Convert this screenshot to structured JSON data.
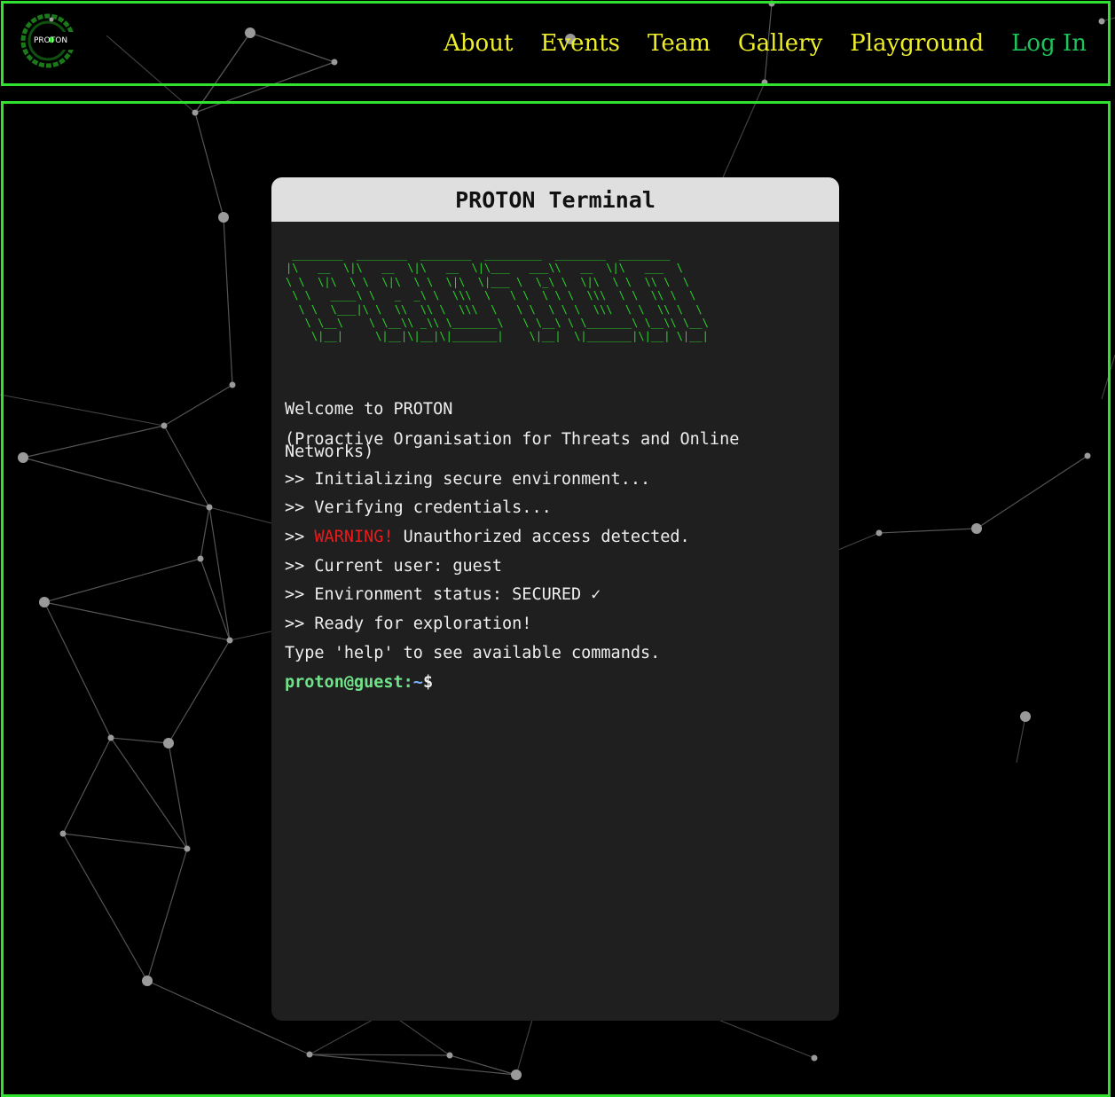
{
  "brand": {
    "logo_text": "PROTON",
    "accent": "#2fe32f"
  },
  "nav": {
    "items": [
      {
        "label": "About"
      },
      {
        "label": "Events"
      },
      {
        "label": "Team"
      },
      {
        "label": "Gallery"
      },
      {
        "label": "Playground"
      }
    ],
    "login_label": "Log In",
    "link_color": "#eded2a",
    "login_color": "#1ec45a"
  },
  "terminal": {
    "title": "PROTON Terminal",
    "ascii_art": " ________  ________  ________  _________  ________  ________      \n|\\   __  \\|\\   __  \\|\\   __  \\|\\___   ___\\\\   __  \\|\\   ___  \\    \n\\ \\  \\|\\  \\ \\  \\|\\  \\ \\  \\|\\  \\|___ \\  \\_\\ \\  \\|\\  \\ \\  \\\\ \\  \\   \n \\ \\   ____\\ \\   _  _\\ \\  \\\\\\  \\   \\ \\  \\ \\ \\  \\\\\\  \\ \\  \\\\ \\  \\  \n  \\ \\  \\___|\\ \\  \\\\  \\\\ \\  \\\\\\  \\   \\ \\  \\ \\ \\  \\\\\\  \\ \\  \\\\ \\  \\ \n   \\ \\__\\    \\ \\__\\\\ _\\\\ \\_______\\   \\ \\__\\ \\ \\_______\\ \\__\\\\ \\__\\\n    \\|__|     \\|__|\\|__|\\|_______|    \\|__|  \\|_______|\\|__| \\|__|",
    "lines": {
      "welcome": "Welcome to PROTON",
      "fullname": "(Proactive Organisation for Threats and Online Networks)",
      "init": ">> Initializing secure environment...",
      "verify": ">> Verifying credentials...",
      "warn_prefix": ">> ",
      "warn_word": "WARNING!",
      "warn_rest": " Unauthorized access detected.",
      "user": ">> Current user: guest",
      "status": ">> Environment status: SECURED ✓",
      "ready": ">> Ready for exploration!",
      "help": "Type 'help' to see available commands."
    },
    "prompt": {
      "user": "proton@guest:",
      "dir": "~",
      "symbol": "$",
      "value": ""
    },
    "colors": {
      "ascii": "#27d527",
      "warning": "#e81c1c"
    }
  }
}
